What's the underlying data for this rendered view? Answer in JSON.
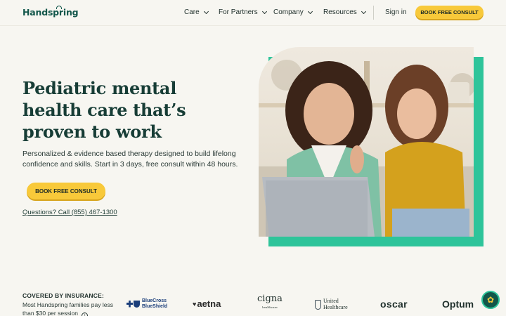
{
  "header": {
    "logo": "Handspring",
    "nav": [
      {
        "label": "Care"
      },
      {
        "label": "For Partners"
      },
      {
        "label": "Company"
      },
      {
        "label": "Resources"
      }
    ],
    "signin": "Sign in",
    "cta": "BOOK FREE CONSULT"
  },
  "hero": {
    "headline_1": "Pediatric mental",
    "headline_2": "health care that’s",
    "headline_3": "proven to work",
    "subtext": "Personalized & evidence based therapy designed to build lifelong confidence and skills. Start in 3 days, free consult within 48 hours.",
    "cta": "BOOK FREE CONSULT",
    "phone_link": "Questions? Call (855) 467-1300"
  },
  "insurance": {
    "title": "COVERED BY INSURANCE:",
    "text": "Most Handspring families pay less than $30 per session",
    "logos": {
      "bcbs_1": "BlueCross",
      "bcbs_2": "BlueShield",
      "aetna": "aetna",
      "cigna": "cigna",
      "cigna_sub": "healthcare",
      "uhc_1": "United",
      "uhc_2": "Healthcare",
      "oscar": "oscar",
      "optum": "Optum"
    }
  },
  "colors": {
    "accent_yellow": "#f8c93a",
    "accent_green": "#2ec49a",
    "brand_dark_green": "#12564a",
    "background": "#f7f6f1"
  },
  "icons": [
    "chevron-down-icon",
    "info-icon",
    "chat-icon",
    "bcbs-logo",
    "uhc-logo"
  ]
}
